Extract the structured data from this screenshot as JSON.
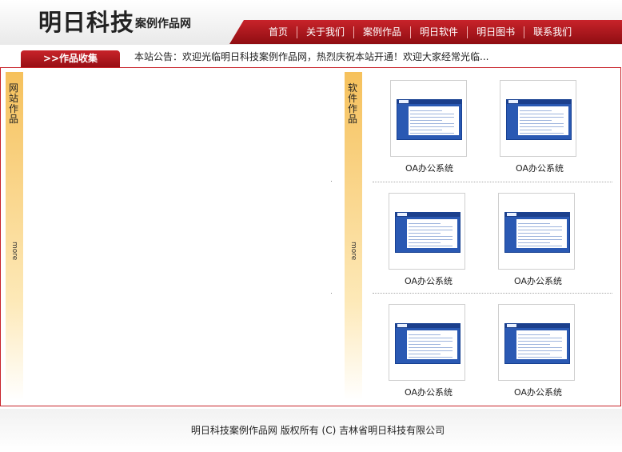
{
  "header": {
    "logo_main": "明日科技",
    "logo_sub": "案例作品网"
  },
  "nav": {
    "items": [
      "首页",
      "关于我们",
      "案例作品",
      "明日软件",
      "明日图书",
      "联系我们"
    ]
  },
  "collect_tab": ">>作品收集",
  "notice": "本站公告：欢迎光临明日科技案例作品网，热烈庆祝本站开通！欢迎大家经常光临...",
  "left_section": {
    "label": "网站作品",
    "more": "more"
  },
  "right_section": {
    "label": "软件作品",
    "more": "more"
  },
  "works": [
    {
      "label": "OA办公系统"
    },
    {
      "label": "OA办公系统"
    },
    {
      "label": "OA办公系统"
    },
    {
      "label": "OA办公系统"
    },
    {
      "label": "OA办公系统"
    },
    {
      "label": "OA办公系统"
    }
  ],
  "footer": {
    "text": "明日科技案例作品网  版权所有 (C) 吉林省明日科技有限公司"
  },
  "colors": {
    "brand_red": "#c8232a",
    "sidebar_gold": "#f6c15c",
    "thumb_blue": "#2a59b3"
  }
}
